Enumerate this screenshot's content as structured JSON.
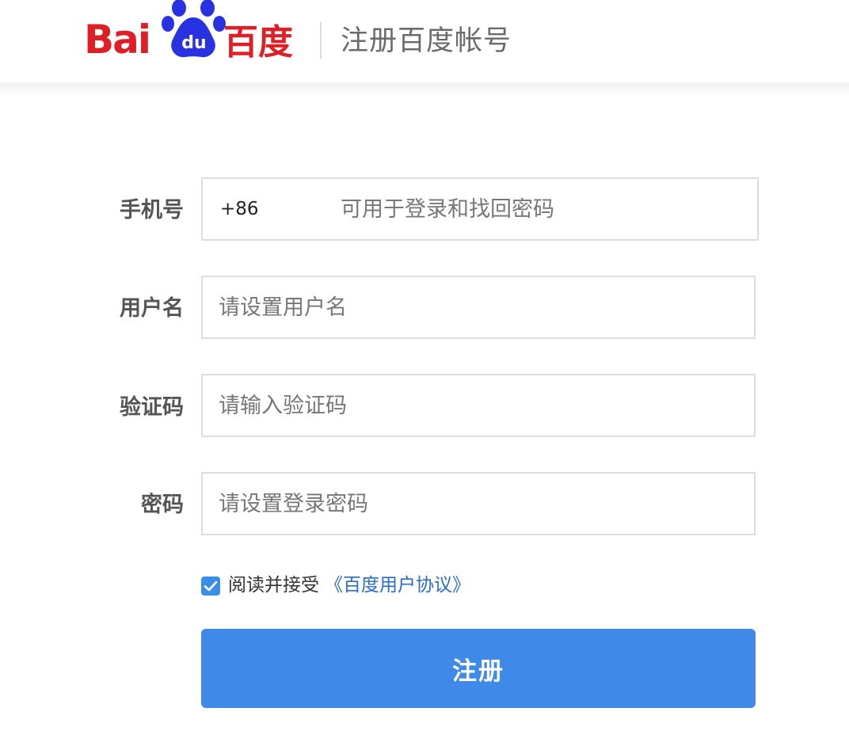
{
  "header": {
    "logo_latin": "Bai",
    "logo_paw_text": "du",
    "logo_chinese": "百度",
    "title": "注册百度帐号",
    "brand_red": "#de1f26",
    "brand_blue": "#2932e1"
  },
  "form": {
    "phone": {
      "label": "手机号",
      "prefix": "+86",
      "placeholder": "可用于登录和找回密码"
    },
    "username": {
      "label": "用户名",
      "placeholder": "请设置用户名"
    },
    "captcha": {
      "label": "验证码",
      "placeholder": "请输入验证码"
    },
    "password": {
      "label": "密码",
      "placeholder": "请设置登录密码"
    },
    "agreement": {
      "checked": true,
      "text": "阅读并接受",
      "link": "《百度用户协议》"
    },
    "submit_label": "注册",
    "accent": "#3f8ae8"
  }
}
